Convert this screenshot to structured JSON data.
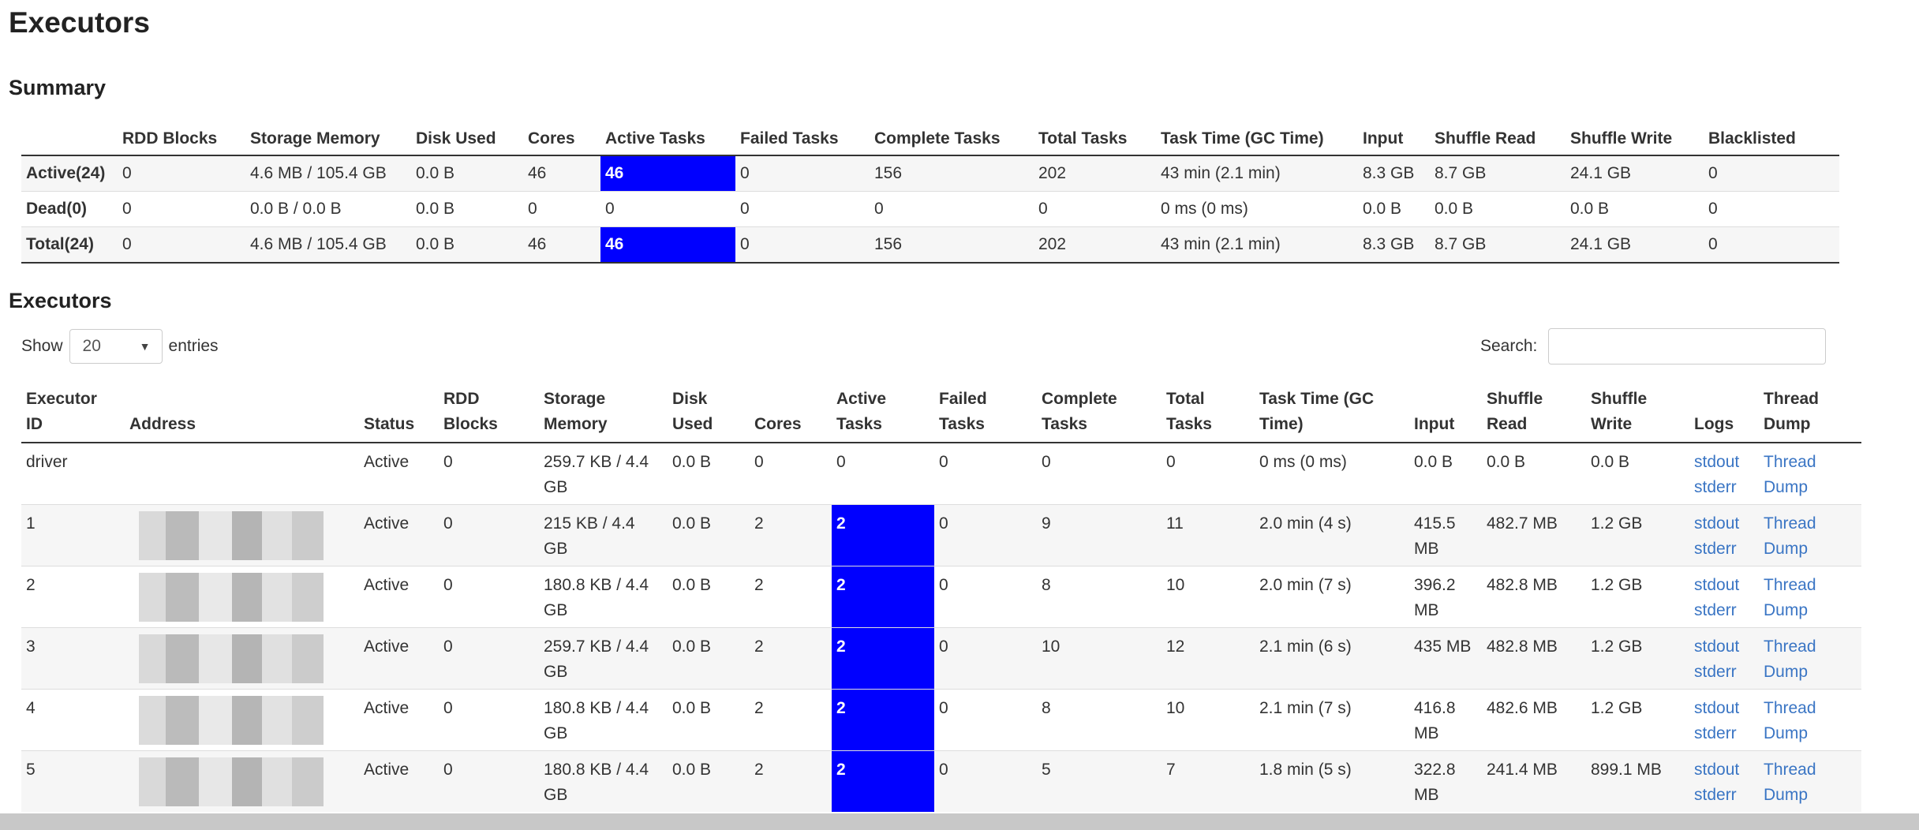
{
  "page_title": "Executors",
  "summary": {
    "heading": "Summary",
    "columns": [
      "",
      "RDD Blocks",
      "Storage Memory",
      "Disk Used",
      "Cores",
      "Active Tasks",
      "Failed Tasks",
      "Complete Tasks",
      "Total Tasks",
      "Task Time (GC Time)",
      "Input",
      "Shuffle Read",
      "Shuffle Write",
      "Blacklisted"
    ],
    "rows": [
      {
        "label": "Active(24)",
        "rdd": "0",
        "storage": "4.6 MB / 105.4 GB",
        "disk": "0.0 B",
        "cores": "46",
        "active": "46",
        "failed": "0",
        "complete": "156",
        "total": "202",
        "task_time": "43 min (2.1 min)",
        "input": "8.3 GB",
        "shuffle_read": "8.7 GB",
        "shuffle_write": "24.1 GB",
        "blacklisted": "0"
      },
      {
        "label": "Dead(0)",
        "rdd": "0",
        "storage": "0.0 B / 0.0 B",
        "disk": "0.0 B",
        "cores": "0",
        "active": "0",
        "failed": "0",
        "complete": "0",
        "total": "0",
        "task_time": "0 ms (0 ms)",
        "input": "0.0 B",
        "shuffle_read": "0.0 B",
        "shuffle_write": "0.0 B",
        "blacklisted": "0"
      },
      {
        "label": "Total(24)",
        "rdd": "0",
        "storage": "4.6 MB / 105.4 GB",
        "disk": "0.0 B",
        "cores": "46",
        "active": "46",
        "failed": "0",
        "complete": "156",
        "total": "202",
        "task_time": "43 min (2.1 min)",
        "input": "8.3 GB",
        "shuffle_read": "8.7 GB",
        "shuffle_write": "24.1 GB",
        "blacklisted": "0"
      }
    ]
  },
  "executors": {
    "heading": "Executors",
    "show_label": "Show",
    "entries_value": "20",
    "entries_label": "entries",
    "search_label": "Search:",
    "search_value": "",
    "columns": {
      "id": [
        "Executor",
        "ID"
      ],
      "address": [
        "",
        "Address"
      ],
      "status": [
        "",
        "Status"
      ],
      "rdd": [
        "RDD",
        "Blocks"
      ],
      "storage": [
        "Storage",
        "Memory"
      ],
      "disk": [
        "Disk",
        "Used"
      ],
      "cores": [
        "",
        "Cores"
      ],
      "active": [
        "Active",
        "Tasks"
      ],
      "failed": [
        "Failed",
        "Tasks"
      ],
      "complete": [
        "Complete",
        "Tasks"
      ],
      "total": [
        "Total",
        "Tasks"
      ],
      "task_time": [
        "Task Time (GC",
        "Time)"
      ],
      "input": [
        "",
        "Input"
      ],
      "shuffle_read": [
        "Shuffle",
        "Read"
      ],
      "shuffle_write": [
        "Shuffle",
        "Write"
      ],
      "logs": [
        "",
        "Logs"
      ],
      "thread_dump": [
        "Thread",
        "Dump"
      ]
    },
    "rows": [
      {
        "id": "driver",
        "status": "Active",
        "rdd": "0",
        "storage": "259.7 KB / 4.4 GB",
        "disk": "0.0 B",
        "cores": "0",
        "active": "0",
        "failed": "0",
        "complete": "0",
        "total": "0",
        "task_time": "0 ms (0 ms)",
        "input": "0.0 B",
        "shuffle_read": "0.0 B",
        "shuffle_write": "0.0 B",
        "stdout": "stdout",
        "stderr": "stderr",
        "thread": "Thread",
        "dump": "Dump",
        "highlight": false
      },
      {
        "id": "1",
        "status": "Active",
        "rdd": "0",
        "storage": "215 KB / 4.4 GB",
        "disk": "0.0 B",
        "cores": "2",
        "active": "2",
        "failed": "0",
        "complete": "9",
        "total": "11",
        "task_time": "2.0 min (4 s)",
        "input": "415.5 MB",
        "shuffle_read": "482.7 MB",
        "shuffle_write": "1.2 GB",
        "stdout": "stdout",
        "stderr": "stderr",
        "thread": "Thread",
        "dump": "Dump",
        "highlight": true
      },
      {
        "id": "2",
        "status": "Active",
        "rdd": "0",
        "storage": "180.8 KB / 4.4 GB",
        "disk": "0.0 B",
        "cores": "2",
        "active": "2",
        "failed": "0",
        "complete": "8",
        "total": "10",
        "task_time": "2.0 min (7 s)",
        "input": "396.2 MB",
        "shuffle_read": "482.8 MB",
        "shuffle_write": "1.2 GB",
        "stdout": "stdout",
        "stderr": "stderr",
        "thread": "Thread",
        "dump": "Dump",
        "highlight": true
      },
      {
        "id": "3",
        "status": "Active",
        "rdd": "0",
        "storage": "259.7 KB / 4.4 GB",
        "disk": "0.0 B",
        "cores": "2",
        "active": "2",
        "failed": "0",
        "complete": "10",
        "total": "12",
        "task_time": "2.1 min (6 s)",
        "input": "435 MB",
        "shuffle_read": "482.8 MB",
        "shuffle_write": "1.2 GB",
        "stdout": "stdout",
        "stderr": "stderr",
        "thread": "Thread",
        "dump": "Dump",
        "highlight": true
      },
      {
        "id": "4",
        "status": "Active",
        "rdd": "0",
        "storage": "180.8 KB / 4.4 GB",
        "disk": "0.0 B",
        "cores": "2",
        "active": "2",
        "failed": "0",
        "complete": "8",
        "total": "10",
        "task_time": "2.1 min (7 s)",
        "input": "416.8 MB",
        "shuffle_read": "482.6 MB",
        "shuffle_write": "1.2 GB",
        "stdout": "stdout",
        "stderr": "stderr",
        "thread": "Thread",
        "dump": "Dump",
        "highlight": true
      },
      {
        "id": "5",
        "status": "Active",
        "rdd": "0",
        "storage": "180.8 KB / 4.4 GB",
        "disk": "0.0 B",
        "cores": "2",
        "active": "2",
        "failed": "0",
        "complete": "5",
        "total": "7",
        "task_time": "1.8 min (5 s)",
        "input": "322.8 MB",
        "shuffle_read": "241.4 MB",
        "shuffle_write": "899.1 MB",
        "stdout": "stdout",
        "stderr": "stderr",
        "thread": "Thread",
        "dump": "Dump",
        "highlight": true
      }
    ]
  },
  "colors": {
    "active_tasks_highlight": "#0000ff",
    "link": "#3a75c4"
  },
  "icons": {
    "select_caret": "caret-down-icon"
  }
}
